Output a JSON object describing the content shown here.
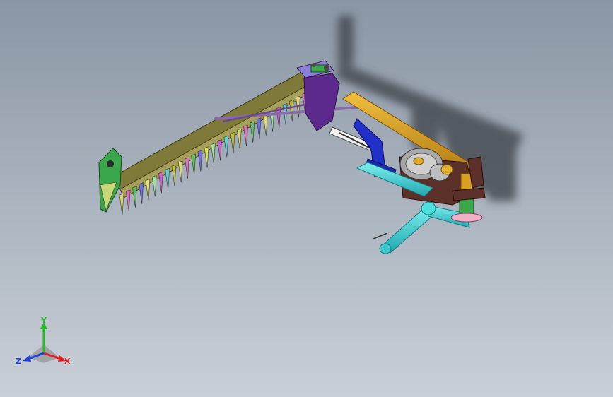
{
  "viewport": {
    "background_top": "#8a96a4",
    "background_bottom": "#c9cfd7"
  },
  "triad": {
    "x_label": "X",
    "y_label": "Y",
    "z_label": "Z",
    "x_color": "#e02020",
    "y_color": "#20c020",
    "z_color": "#2040e0"
  },
  "model": {
    "icon": "mower-assembly-icon",
    "colors": {
      "cutter_bar": "#7f7a3a",
      "frame_purple": "#5c2a8c",
      "yellow_bar": "#e0a820",
      "cyan_frame": "#38d8d8",
      "gearbox": "#5a3028",
      "pulley": "#c0c0c0",
      "shadow": "#3a3f46"
    }
  }
}
